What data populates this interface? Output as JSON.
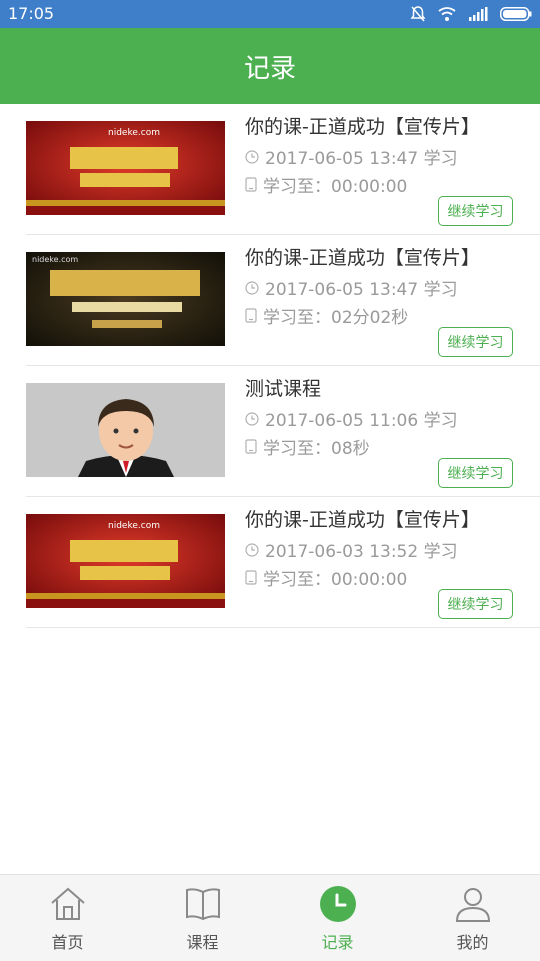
{
  "status_bar": {
    "time": "17:05"
  },
  "header": {
    "title": "记录"
  },
  "records": [
    {
      "thumb": "nideke-promo-red",
      "thumb_text": "nideke.com",
      "title": "你的课-正道成功【宣传片】",
      "date": "2017-06-05 13:47 学习",
      "progress": "学习至：00:00:00",
      "button": "继续学习"
    },
    {
      "thumb": "shock-arrival-dark",
      "thumb_text": "nideke.com",
      "title": "你的课-正道成功【宣传片】",
      "date": "2017-06-05 13:47 学习",
      "progress": "学习至：02分02秒",
      "button": "继续学习"
    },
    {
      "thumb": "cartoon-man-avatar",
      "thumb_text": "",
      "title": "测试课程",
      "date": "2017-06-05 11:06 学习",
      "progress": "学习至：08秒",
      "button": "继续学习"
    },
    {
      "thumb": "nideke-promo-red",
      "thumb_text": "nideke.com",
      "title": "你的课-正道成功【宣传片】",
      "date": "2017-06-03 13:52 学习",
      "progress": "学习至：00:00:00",
      "button": "继续学习"
    }
  ],
  "tabs": [
    {
      "label": "首页",
      "icon": "home-icon"
    },
    {
      "label": "课程",
      "icon": "book-icon"
    },
    {
      "label": "记录",
      "icon": "clock-icon",
      "active": true
    },
    {
      "label": "我的",
      "icon": "user-icon"
    }
  ],
  "colors": {
    "accent": "#4caf50",
    "status_bar": "#3f7fc9"
  }
}
